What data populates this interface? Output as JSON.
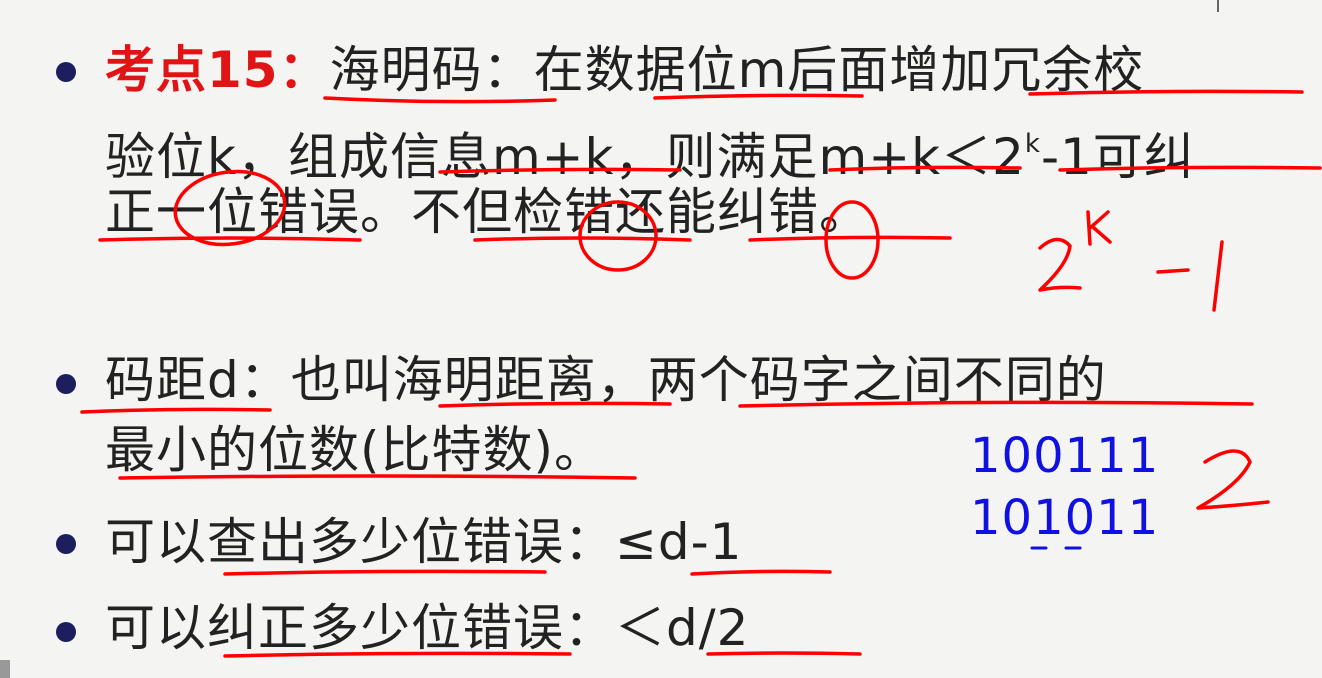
{
  "bullets": [
    {
      "label": "考点15：",
      "lines": [
        "海明码：在数据位m后面增加冗余校",
        "验位k，组成信息m+k，则满足m+k＜2",
        "正一位错误。不但检错还能纠错。"
      ],
      "sup": "k",
      "line2_tail": "-1可纠"
    },
    {
      "lines": [
        "码距d：也叫海明距离，两个码字之间不同的",
        "最小的位数(比特数)。"
      ]
    },
    {
      "lines": [
        "可以查出多少位错误：≤d-1"
      ]
    },
    {
      "lines": [
        "可以纠正多少位错误：＜d/2"
      ]
    }
  ],
  "example_codes": [
    "100111",
    "101011"
  ],
  "handwriting": {
    "formula": "2^k -1",
    "distance": "2",
    "color": "#ff0000"
  },
  "colors": {
    "label_red": "#e01414",
    "bullet": "#1c1e5e",
    "code_blue": "#1010e0"
  }
}
